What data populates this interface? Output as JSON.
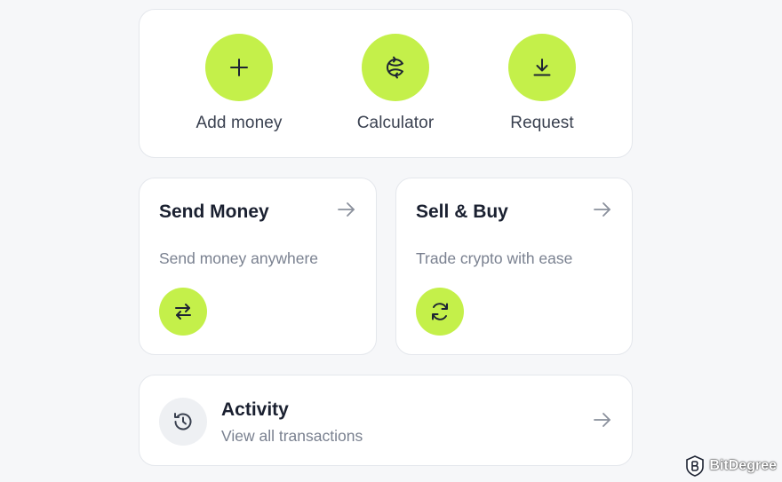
{
  "colors": {
    "accent": "#c4f04a",
    "page_bg": "#f6f7f9",
    "card_bg": "#ffffff",
    "icon_dark": "#1e2433",
    "muted_text": "#7a8190"
  },
  "quick_actions": [
    {
      "label": "Add money",
      "icon": "plus-icon"
    },
    {
      "label": "Calculator",
      "icon": "currency-exchange-icon"
    },
    {
      "label": "Request",
      "icon": "download-icon"
    }
  ],
  "tiles": {
    "send": {
      "title": "Send Money",
      "subtitle": "Send money anywhere",
      "icon": "swap-arrows-icon"
    },
    "sell": {
      "title": "Sell & Buy",
      "subtitle": "Trade crypto with ease",
      "icon": "refresh-icon"
    }
  },
  "activity": {
    "title": "Activity",
    "subtitle": "View all transactions",
    "icon": "history-icon"
  },
  "watermark": {
    "text": "BitDegree"
  }
}
